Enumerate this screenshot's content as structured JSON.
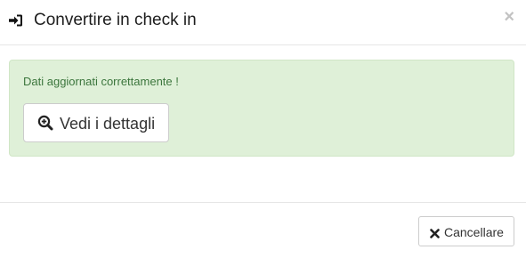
{
  "modal": {
    "title": "Convertire in check in",
    "title_icon": "sign-in-icon",
    "close_label": "×",
    "alert": {
      "message": "Dati aggiornati correttamente !",
      "details_button": {
        "label": "Vedi i dettagli",
        "icon": "search-plus-icon"
      }
    },
    "footer": {
      "cancel_button": {
        "label": "Cancellare",
        "icon": "times-icon"
      }
    }
  },
  "colors": {
    "alert_background": "#dff0d8",
    "alert_text": "#3c763d"
  }
}
